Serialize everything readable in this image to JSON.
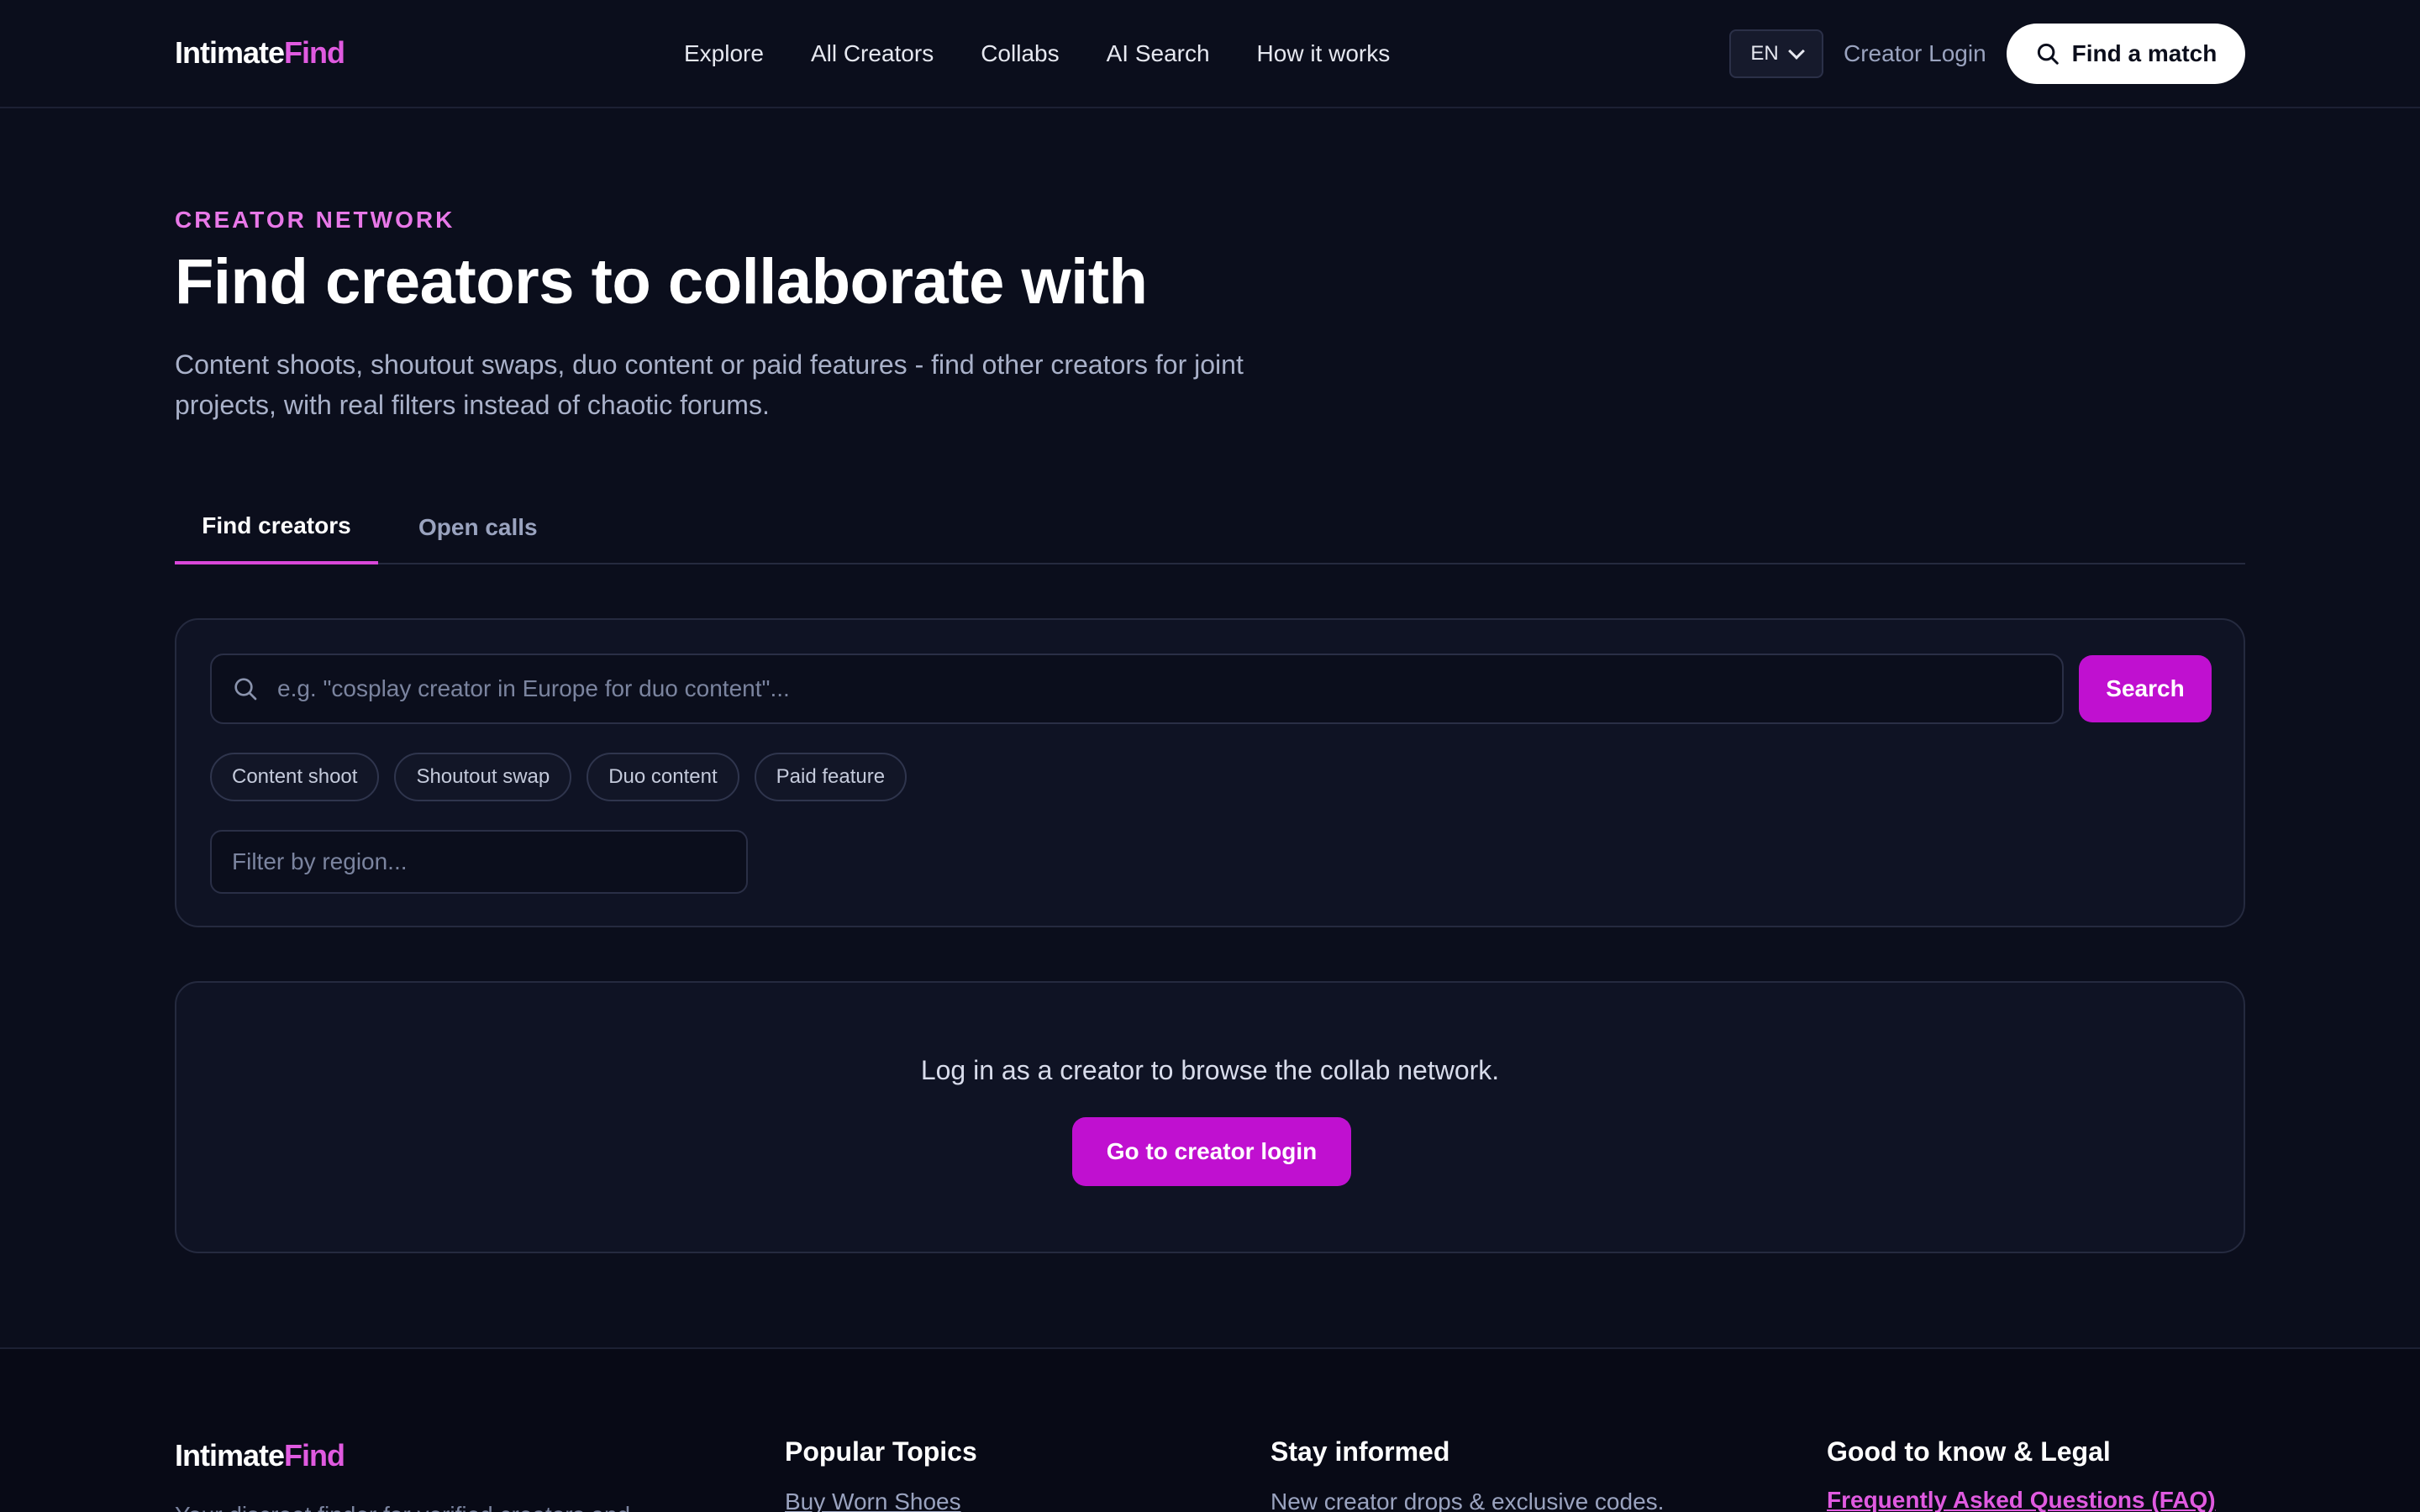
{
  "header": {
    "logo_main": "Intimate",
    "logo_accent": "Find",
    "nav": [
      "Explore",
      "All Creators",
      "Collabs",
      "AI Search",
      "How it works"
    ],
    "language": "EN",
    "creator_login": "Creator Login",
    "find_match": "Find a match"
  },
  "hero": {
    "eyebrow": "CREATOR NETWORK",
    "title": "Find creators to collaborate with",
    "subtitle": "Content shoots, shoutout swaps, duo content or paid features - find other creators for joint projects, with real filters instead of chaotic forums."
  },
  "tabs": {
    "find_creators": "Find creators",
    "open_calls": "Open calls"
  },
  "search": {
    "placeholder": "e.g. \"cosplay creator in Europe for duo content\"...",
    "button": "Search",
    "chips": [
      "Content shoot",
      "Shoutout swap",
      "Duo content",
      "Paid feature"
    ],
    "region_placeholder": "Filter by region..."
  },
  "login_card": {
    "message": "Log in as a creator to browse the collab network.",
    "button": "Go to creator login"
  },
  "footer": {
    "logo_main": "Intimate",
    "logo_accent": "Find",
    "tagline": "Your discreet finder for verified creators and",
    "col1_title": "Popular Topics",
    "col1_item": "Buy Worn Shoes",
    "col2_title": "Stay informed",
    "col2_text": "New creator drops & exclusive codes.",
    "col3_title": "Good to know & Legal",
    "col3_link": "Frequently Asked Questions (FAQ)"
  },
  "colors": {
    "background": "#0b0e1c",
    "accent": "#c010d0",
    "accent_text": "#e05ae0"
  }
}
